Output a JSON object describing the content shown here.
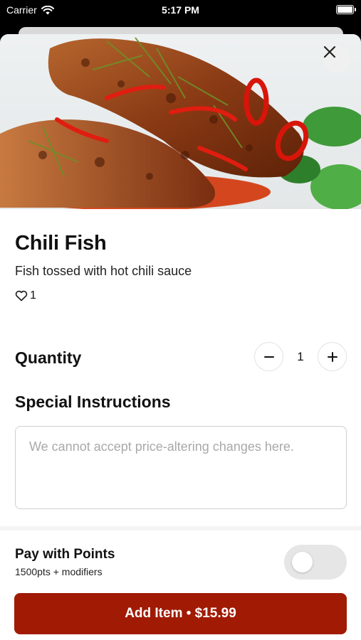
{
  "status_bar": {
    "carrier": "Carrier",
    "time": "5:17 PM"
  },
  "item": {
    "name": "Chili Fish",
    "description": "Fish tossed with hot chili sauce",
    "likes": "1",
    "image_icon": "food-photo"
  },
  "quantity": {
    "label": "Quantity",
    "value": "1"
  },
  "special_instructions": {
    "label": "Special Instructions",
    "placeholder": "We cannot accept price-altering changes here.",
    "value": ""
  },
  "points": {
    "title": "Pay with Points",
    "subtitle": "1500pts + modifiers",
    "enabled": false
  },
  "add_button": {
    "label": "Add Item • $15.99"
  },
  "colors": {
    "accent": "#a11a04",
    "toggle_off": "#e6e6e6",
    "border": "#cfcfcf"
  }
}
